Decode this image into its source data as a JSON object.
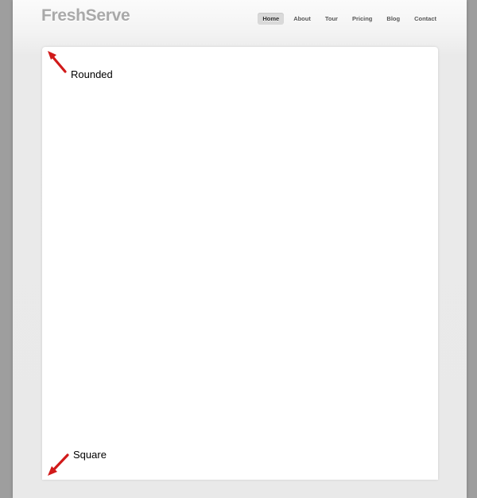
{
  "site": {
    "logo_text": "FreshServe"
  },
  "nav": {
    "items": [
      {
        "label": "Home",
        "active": true
      },
      {
        "label": "About",
        "active": false
      },
      {
        "label": "Tour",
        "active": false
      },
      {
        "label": "Pricing",
        "active": false
      },
      {
        "label": "Blog",
        "active": false
      },
      {
        "label": "Contact",
        "active": false
      }
    ]
  },
  "annotations": {
    "rounded_label": "Rounded",
    "square_label": "Square"
  },
  "colors": {
    "arrow": "#d11a1a",
    "logo": "#a9a9a9",
    "nav_active_bg": "#d9d9d9"
  }
}
